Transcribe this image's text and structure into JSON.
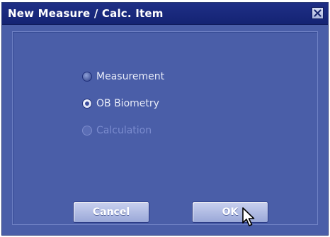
{
  "dialog": {
    "title": "New Measure / Calc. Item"
  },
  "options": [
    {
      "label": "Measurement",
      "state": "unselected"
    },
    {
      "label": "OB Biometry",
      "state": "selected"
    },
    {
      "label": "Calculation",
      "state": "disabled"
    }
  ],
  "buttons": {
    "cancel_label": "Cancel",
    "ok_label": "OK"
  },
  "colors": {
    "dialog_bg": "#4a5ea8",
    "titlebar_bg": "#1f2f86",
    "button_bg": "#b3bfe6"
  },
  "icons": {
    "close": "close-icon",
    "cursor": "mouse-pointer-icon"
  }
}
